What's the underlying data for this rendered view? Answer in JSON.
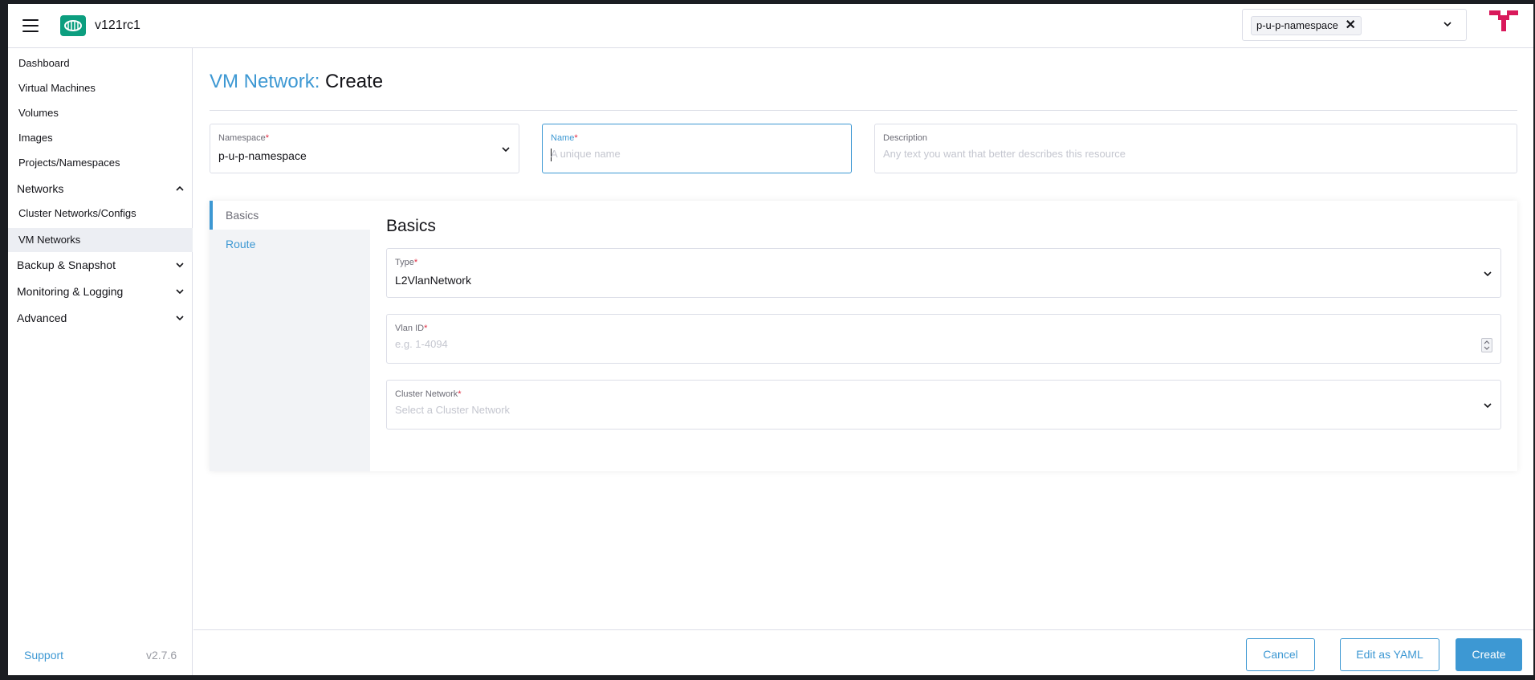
{
  "header": {
    "cluster_name": "v121rc1",
    "namespace_chip": "p-u-p-namespace",
    "namespace_chip_remove": "✕"
  },
  "sidebar": {
    "items": [
      {
        "label": "Dashboard"
      },
      {
        "label": "Virtual Machines"
      },
      {
        "label": "Volumes"
      },
      {
        "label": "Images"
      },
      {
        "label": "Projects/Namespaces"
      }
    ],
    "networks_group": {
      "label": "Networks",
      "expanded": true
    },
    "networks_items": [
      {
        "label": "Cluster Networks/Configs",
        "active": false
      },
      {
        "label": "VM Networks",
        "active": true
      }
    ],
    "groups": [
      {
        "label": "Backup & Snapshot"
      },
      {
        "label": "Monitoring & Logging"
      },
      {
        "label": "Advanced"
      }
    ],
    "support_label": "Support",
    "version": "v2.7.6"
  },
  "page": {
    "title_prefix": "VM Network:",
    "title_action": "Create"
  },
  "form": {
    "namespace": {
      "label": "Namespace",
      "required_mark": "*",
      "value": "p-u-p-namespace"
    },
    "name": {
      "label": "Name",
      "required_mark": "*",
      "placeholder": "A unique name"
    },
    "description": {
      "label": "Description",
      "placeholder": "Any text you want that better describes this resource"
    }
  },
  "tabs": [
    {
      "label": "Basics",
      "active": true
    },
    {
      "label": "Route",
      "active": false
    }
  ],
  "basics": {
    "section_title": "Basics",
    "type": {
      "label": "Type",
      "required_mark": "*",
      "value": "L2VlanNetwork"
    },
    "vlan_id": {
      "label": "Vlan ID",
      "required_mark": "*",
      "placeholder": "e.g. 1-4094"
    },
    "cluster_network": {
      "label": "Cluster Network",
      "required_mark": "*",
      "placeholder": "Select a Cluster Network"
    }
  },
  "footer": {
    "cancel_label": "Cancel",
    "edit_yaml_label": "Edit as YAML",
    "create_label": "Create"
  },
  "colors": {
    "accent": "#3d98d3",
    "brand": "#0c9e7f",
    "required": "#e0283f",
    "user_mark": "#d9195b"
  }
}
